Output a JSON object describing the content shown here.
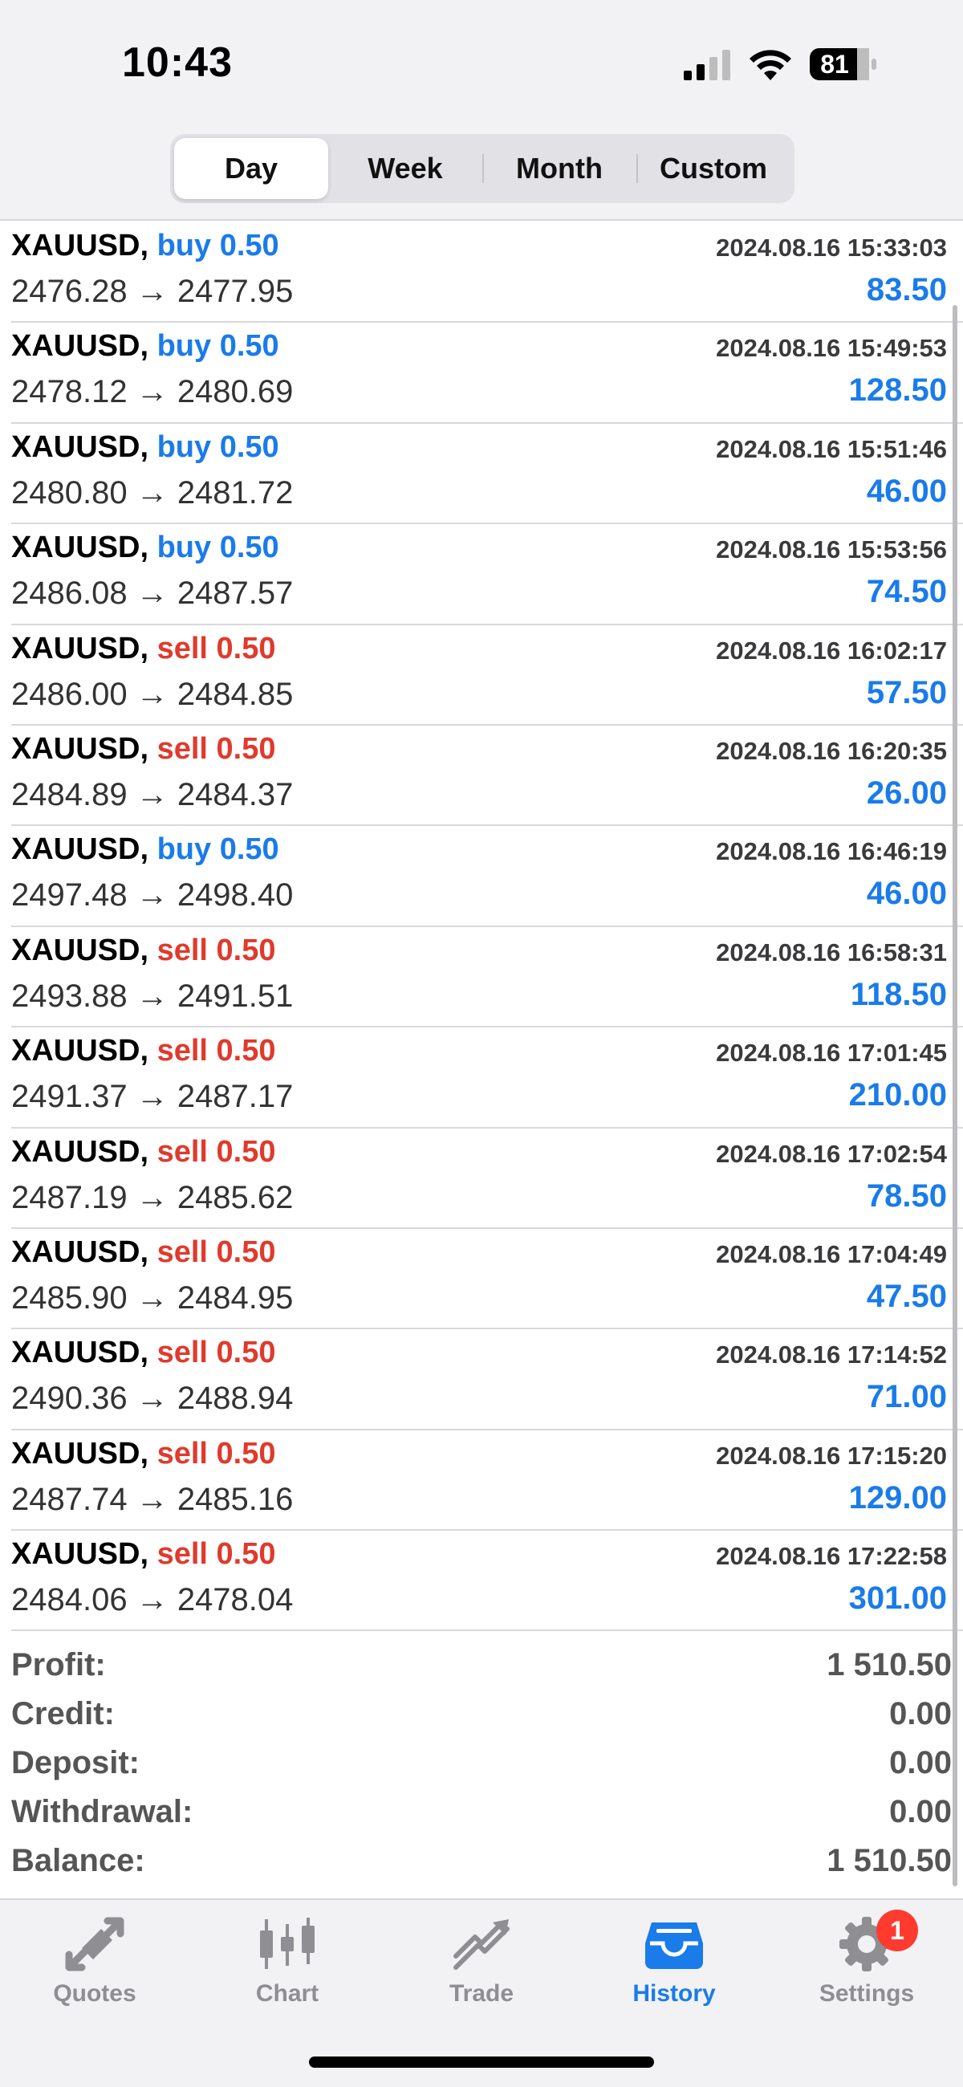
{
  "status_bar": {
    "time": "10:43",
    "battery": "81",
    "icons": [
      "cellular-signal-icon",
      "wifi-icon",
      "battery-icon"
    ]
  },
  "segmented": {
    "options": [
      "Day",
      "Week",
      "Month",
      "Custom"
    ],
    "selected": "Day"
  },
  "deals": [
    {
      "symbol": "XAUUSD,",
      "side": "buy",
      "volume": "0.50",
      "datetime": "2024.08.16 15:33:03",
      "prices": "2476.28 → 2477.95",
      "profit": "83.50"
    },
    {
      "symbol": "XAUUSD,",
      "side": "buy",
      "volume": "0.50",
      "datetime": "2024.08.16 15:49:53",
      "prices": "2478.12 → 2480.69",
      "profit": "128.50"
    },
    {
      "symbol": "XAUUSD,",
      "side": "buy",
      "volume": "0.50",
      "datetime": "2024.08.16 15:51:46",
      "prices": "2480.80 → 2481.72",
      "profit": "46.00"
    },
    {
      "symbol": "XAUUSD,",
      "side": "buy",
      "volume": "0.50",
      "datetime": "2024.08.16 15:53:56",
      "prices": "2486.08 → 2487.57",
      "profit": "74.50"
    },
    {
      "symbol": "XAUUSD,",
      "side": "sell",
      "volume": "0.50",
      "datetime": "2024.08.16 16:02:17",
      "prices": "2486.00 → 2484.85",
      "profit": "57.50"
    },
    {
      "symbol": "XAUUSD,",
      "side": "sell",
      "volume": "0.50",
      "datetime": "2024.08.16 16:20:35",
      "prices": "2484.89 → 2484.37",
      "profit": "26.00"
    },
    {
      "symbol": "XAUUSD,",
      "side": "buy",
      "volume": "0.50",
      "datetime": "2024.08.16 16:46:19",
      "prices": "2497.48 → 2498.40",
      "profit": "46.00"
    },
    {
      "symbol": "XAUUSD,",
      "side": "sell",
      "volume": "0.50",
      "datetime": "2024.08.16 16:58:31",
      "prices": "2493.88 → 2491.51",
      "profit": "118.50"
    },
    {
      "symbol": "XAUUSD,",
      "side": "sell",
      "volume": "0.50",
      "datetime": "2024.08.16 17:01:45",
      "prices": "2491.37 → 2487.17",
      "profit": "210.00"
    },
    {
      "symbol": "XAUUSD,",
      "side": "sell",
      "volume": "0.50",
      "datetime": "2024.08.16 17:02:54",
      "prices": "2487.19 → 2485.62",
      "profit": "78.50"
    },
    {
      "symbol": "XAUUSD,",
      "side": "sell",
      "volume": "0.50",
      "datetime": "2024.08.16 17:04:49",
      "prices": "2485.90 → 2484.95",
      "profit": "47.50"
    },
    {
      "symbol": "XAUUSD,",
      "side": "sell",
      "volume": "0.50",
      "datetime": "2024.08.16 17:14:52",
      "prices": "2490.36 → 2488.94",
      "profit": "71.00"
    },
    {
      "symbol": "XAUUSD,",
      "side": "sell",
      "volume": "0.50",
      "datetime": "2024.08.16 17:15:20",
      "prices": "2487.74 → 2485.16",
      "profit": "129.00"
    },
    {
      "symbol": "XAUUSD,",
      "side": "sell",
      "volume": "0.50",
      "datetime": "2024.08.16 17:22:58",
      "prices": "2484.06 → 2478.04",
      "profit": "301.00"
    }
  ],
  "totals": [
    {
      "label": "Profit:",
      "value": "1 510.50"
    },
    {
      "label": "Credit:",
      "value": "0.00"
    },
    {
      "label": "Deposit:",
      "value": "0.00"
    },
    {
      "label": "Withdrawal:",
      "value": "0.00"
    },
    {
      "label": "Balance:",
      "value": "1 510.50"
    }
  ],
  "tabbar": {
    "tabs": [
      {
        "label": "Quotes",
        "icon": "quotes-arrows-icon"
      },
      {
        "label": "Chart",
        "icon": "candlestick-chart-icon"
      },
      {
        "label": "Trade",
        "icon": "trade-trend-icon"
      },
      {
        "label": "History",
        "icon": "inbox-tray-icon"
      },
      {
        "label": "Settings",
        "icon": "gear-icon"
      }
    ],
    "selected": "History",
    "settings_badge": "1"
  },
  "colors": {
    "accent": "#1a7bea",
    "sell": "#e03a2c",
    "badge": "#ff3b30"
  }
}
